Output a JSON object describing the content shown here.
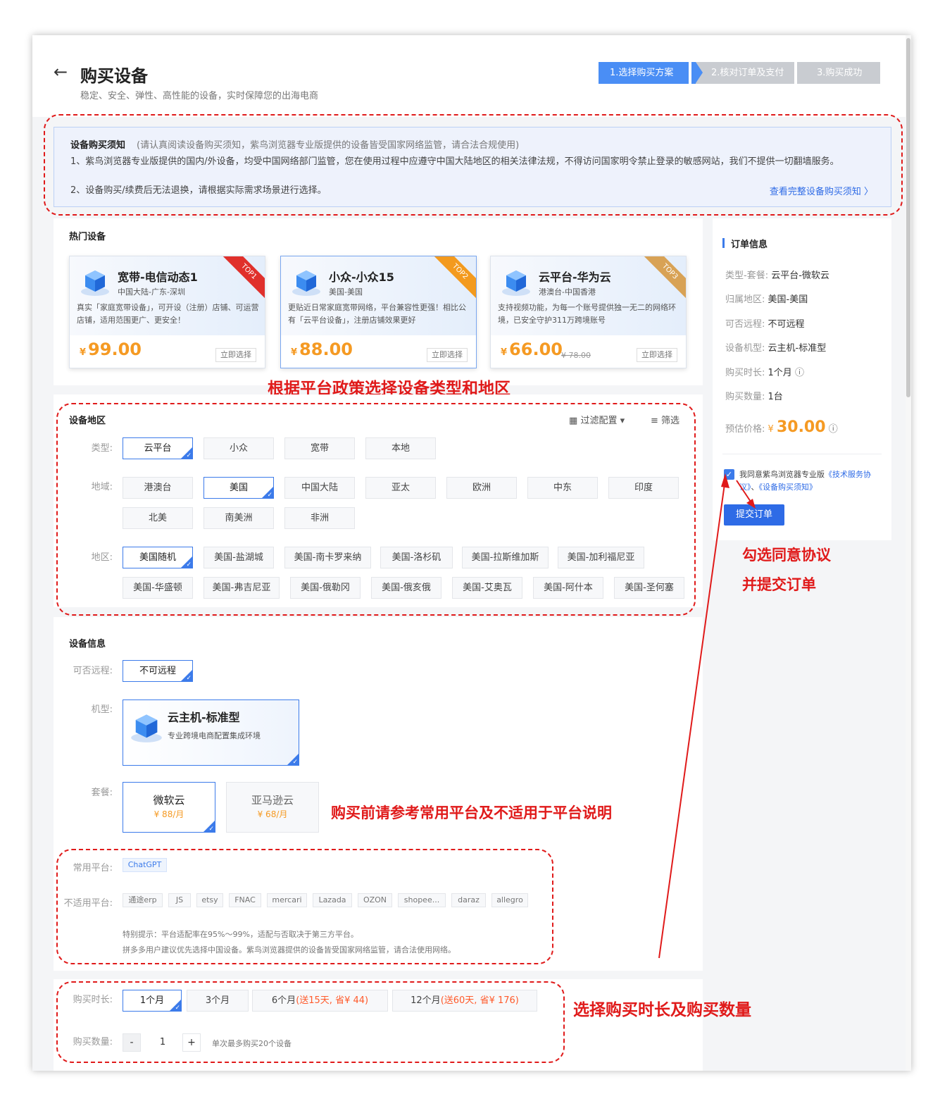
{
  "header": {
    "back_icon": "←",
    "title": "购买设备",
    "subtitle": "稳定、安全、弹性、高性能的设备，实时保障您的出海电商",
    "steps": [
      "1.选择购买方案",
      "2.核对订单及支付",
      "3.购买成功"
    ]
  },
  "notice": {
    "title": "设备购买须知",
    "title_suffix": "(请认真阅读设备购买须知，紫鸟浏览器专业版提供的设备皆受国家网络监管，请合法合规使用)",
    "line1": "1、紫鸟浏览器专业版提供的国内/外设备，均受中国网络部门监管，您在使用过程中应遵守中国大陆地区的相关法律法规，不得访问国家明令禁止登录的敏感网站，我们不提供一切翻墙服务。",
    "line2": "2、设备购买/续费后无法退换，请根据实际需求场景进行选择。",
    "link": "查看完整设备购买须知"
  },
  "hot": {
    "title": "热门设备",
    "cards": [
      {
        "name": "宽带-电信动态1",
        "location": "中国大陆-广东-深圳",
        "desc": "真实「家庭宽带设备」，可开设（注册）店铺、可运营店铺，适用范围更广、更安全！",
        "price": "99.00",
        "old_price": "",
        "button": "立即选择",
        "rank": "TOP1"
      },
      {
        "name": "小众-小众15",
        "location": "美国-美国",
        "desc": "更贴近日常家庭宽带网络，平台兼容性更强！相比公有「云平台设备」，注册店铺效果更好",
        "price": "88.00",
        "old_price": "",
        "button": "立即选择",
        "rank": "TOP2"
      },
      {
        "name": "云平台-华为云",
        "location": "港澳台-中国香港",
        "desc": "支持视频功能，为每一个账号提供独一无二的网络环境，已安全守护311万跨境账号",
        "price": "66.00",
        "old_price": "¥ 78.00",
        "button": "立即选择",
        "rank": "TOP3"
      }
    ],
    "currency": "¥"
  },
  "region": {
    "title": "设备地区",
    "filter_config": "过滤配置",
    "filter": "筛选",
    "type_label": "类型:",
    "types": [
      "云平台",
      "小众",
      "宽带",
      "本地"
    ],
    "area_label": "地域:",
    "areas": [
      "港澳台",
      "美国",
      "中国大陆",
      "亚太",
      "欧洲",
      "中东",
      "印度",
      "北美",
      "南美洲",
      "非洲"
    ],
    "zone_label": "地区:",
    "zones": [
      "美国随机",
      "美国-盐湖城",
      "美国-南卡罗来纳",
      "美国-洛杉矶",
      "美国-拉斯维加斯",
      "美国-加利福尼亚",
      "美国-华盛顿",
      "美国-弗吉尼亚",
      "美国-俄勒冈",
      "美国-俄亥俄",
      "美国-艾奥瓦",
      "美国-阿什本",
      "美国-圣何塞"
    ]
  },
  "device": {
    "title": "设备信息",
    "remote_label": "可否远程:",
    "remote_value": "不可远程",
    "model_label": "机型:",
    "model_name": "云主机-标准型",
    "model_desc": "专业跨境电商配置集成环境",
    "package_label": "套餐:",
    "packages": [
      {
        "name": "微软云",
        "price": "¥ 88/月"
      },
      {
        "name": "亚马逊云",
        "price": "¥ 68/月"
      }
    ],
    "common_label": "常用平台:",
    "common": [
      "ChatGPT"
    ],
    "unsuitable_label": "不适用平台:",
    "unsuitable": [
      "通途erp",
      "JS",
      "etsy",
      "FNAC",
      "mercari",
      "Lazada",
      "OZON",
      "shopee...",
      "daraz",
      "allegro"
    ],
    "tip1": "特别提示：平台适配率在95%～99%，适配与否取决于第三方平台。",
    "tip2": "拼多多用户建议优先选择中国设备。紫鸟浏览器提供的设备皆受国家网络监管，请合法使用网络。"
  },
  "purchase": {
    "duration_label": "购买时长:",
    "durations": [
      {
        "text": "1个月",
        "extra": ""
      },
      {
        "text": "3个月",
        "extra": ""
      },
      {
        "text": "6个月",
        "extra": "(送15天, 省¥ 44)"
      },
      {
        "text": "12个月",
        "extra": "(送60天, 省¥ 176)"
      }
    ],
    "qty_label": "购买数量:",
    "minus": "-",
    "qty": "1",
    "plus": "+",
    "qty_hint": "单次最多购买20个设备"
  },
  "order": {
    "title": "订单信息",
    "rows": [
      {
        "k": "类型-套餐:",
        "v": "云平台-微软云"
      },
      {
        "k": "归属地区:",
        "v": "美国-美国"
      },
      {
        "k": "可否远程:",
        "v": "不可远程"
      },
      {
        "k": "设备机型:",
        "v": "云主机-标准型"
      },
      {
        "k": "购买时长:",
        "v": "1个月"
      },
      {
        "k": "购买数量:",
        "v": "1台"
      }
    ],
    "price_label": "预估价格:",
    "currency": "¥",
    "price": "30.00",
    "agree_prefix": "我同意紫鸟浏览器专业版",
    "agree_link1": "《技术服务协议》",
    "agree_sep": "、",
    "agree_link2": "《设备购买须知》",
    "submit": "提交订单"
  },
  "annotations": {
    "a1": "根据平台政策选择设备类型和地区",
    "a2_line1": "勾选同意协议",
    "a2_line2": "并提交订单",
    "a3": "购买前请参考常用平台及不适用于平台说明",
    "a4": "选择购买时长及购买数量"
  },
  "colors": {
    "accent": "#3c7bea",
    "price": "#f59a23",
    "annotation": "#e01a1a"
  }
}
